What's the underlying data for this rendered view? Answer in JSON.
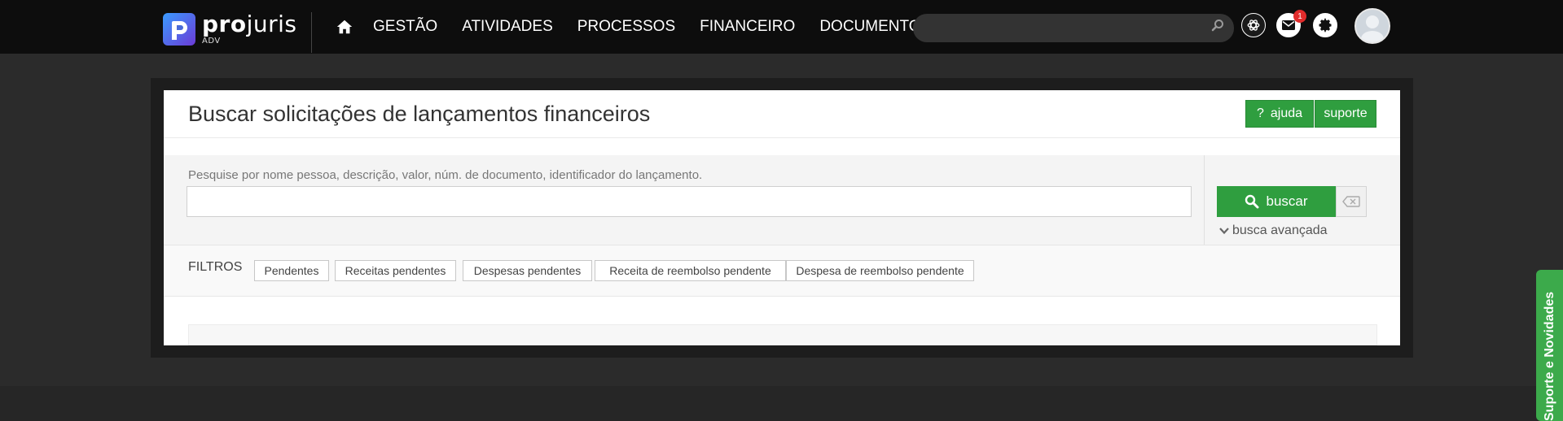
{
  "brand": {
    "name_bold": "pro",
    "name_light": "juris",
    "subtitle": "ADV"
  },
  "nav": {
    "items": [
      "GESTÃO",
      "ATIVIDADES",
      "PROCESSOS",
      "FINANCEIRO",
      "DOCUMENTOS"
    ]
  },
  "header": {
    "search_placeholder": "",
    "notification_count": "1"
  },
  "page": {
    "title": "Buscar solicitações de lançamentos financeiros",
    "help_label": "ajuda",
    "help_icon": "?",
    "support_label": "suporte"
  },
  "search": {
    "label": "Pesquise por nome pessoa, descrição, valor, núm. de documento, identificador do lançamento.",
    "value": "",
    "button_label": "buscar",
    "advanced_label": "busca avançada"
  },
  "filters": {
    "label": "FILTROS",
    "chips": [
      "Pendentes",
      "Receitas pendentes",
      "Despesas pendentes",
      "Receita de reembolso pendente",
      "Despesa de reembolso pendente"
    ]
  },
  "side_tab": {
    "label": "Suporte e Novidades"
  },
  "colors": {
    "topbar": "#0d0d0d",
    "accent_green": "#2f9e3f",
    "side_tab_green": "#3caa4b",
    "badge_red": "#e12b2b",
    "logo_blue": "#3a7bff",
    "logo_purple": "#6b3bd6"
  },
  "icons": {
    "home": "home-icon",
    "search": "search-icon",
    "ai_assistant": "ai-assistant-icon",
    "mail": "mail-icon",
    "settings": "gear-icon",
    "clear": "backspace-icon",
    "chevron": "chevron-down-icon"
  }
}
